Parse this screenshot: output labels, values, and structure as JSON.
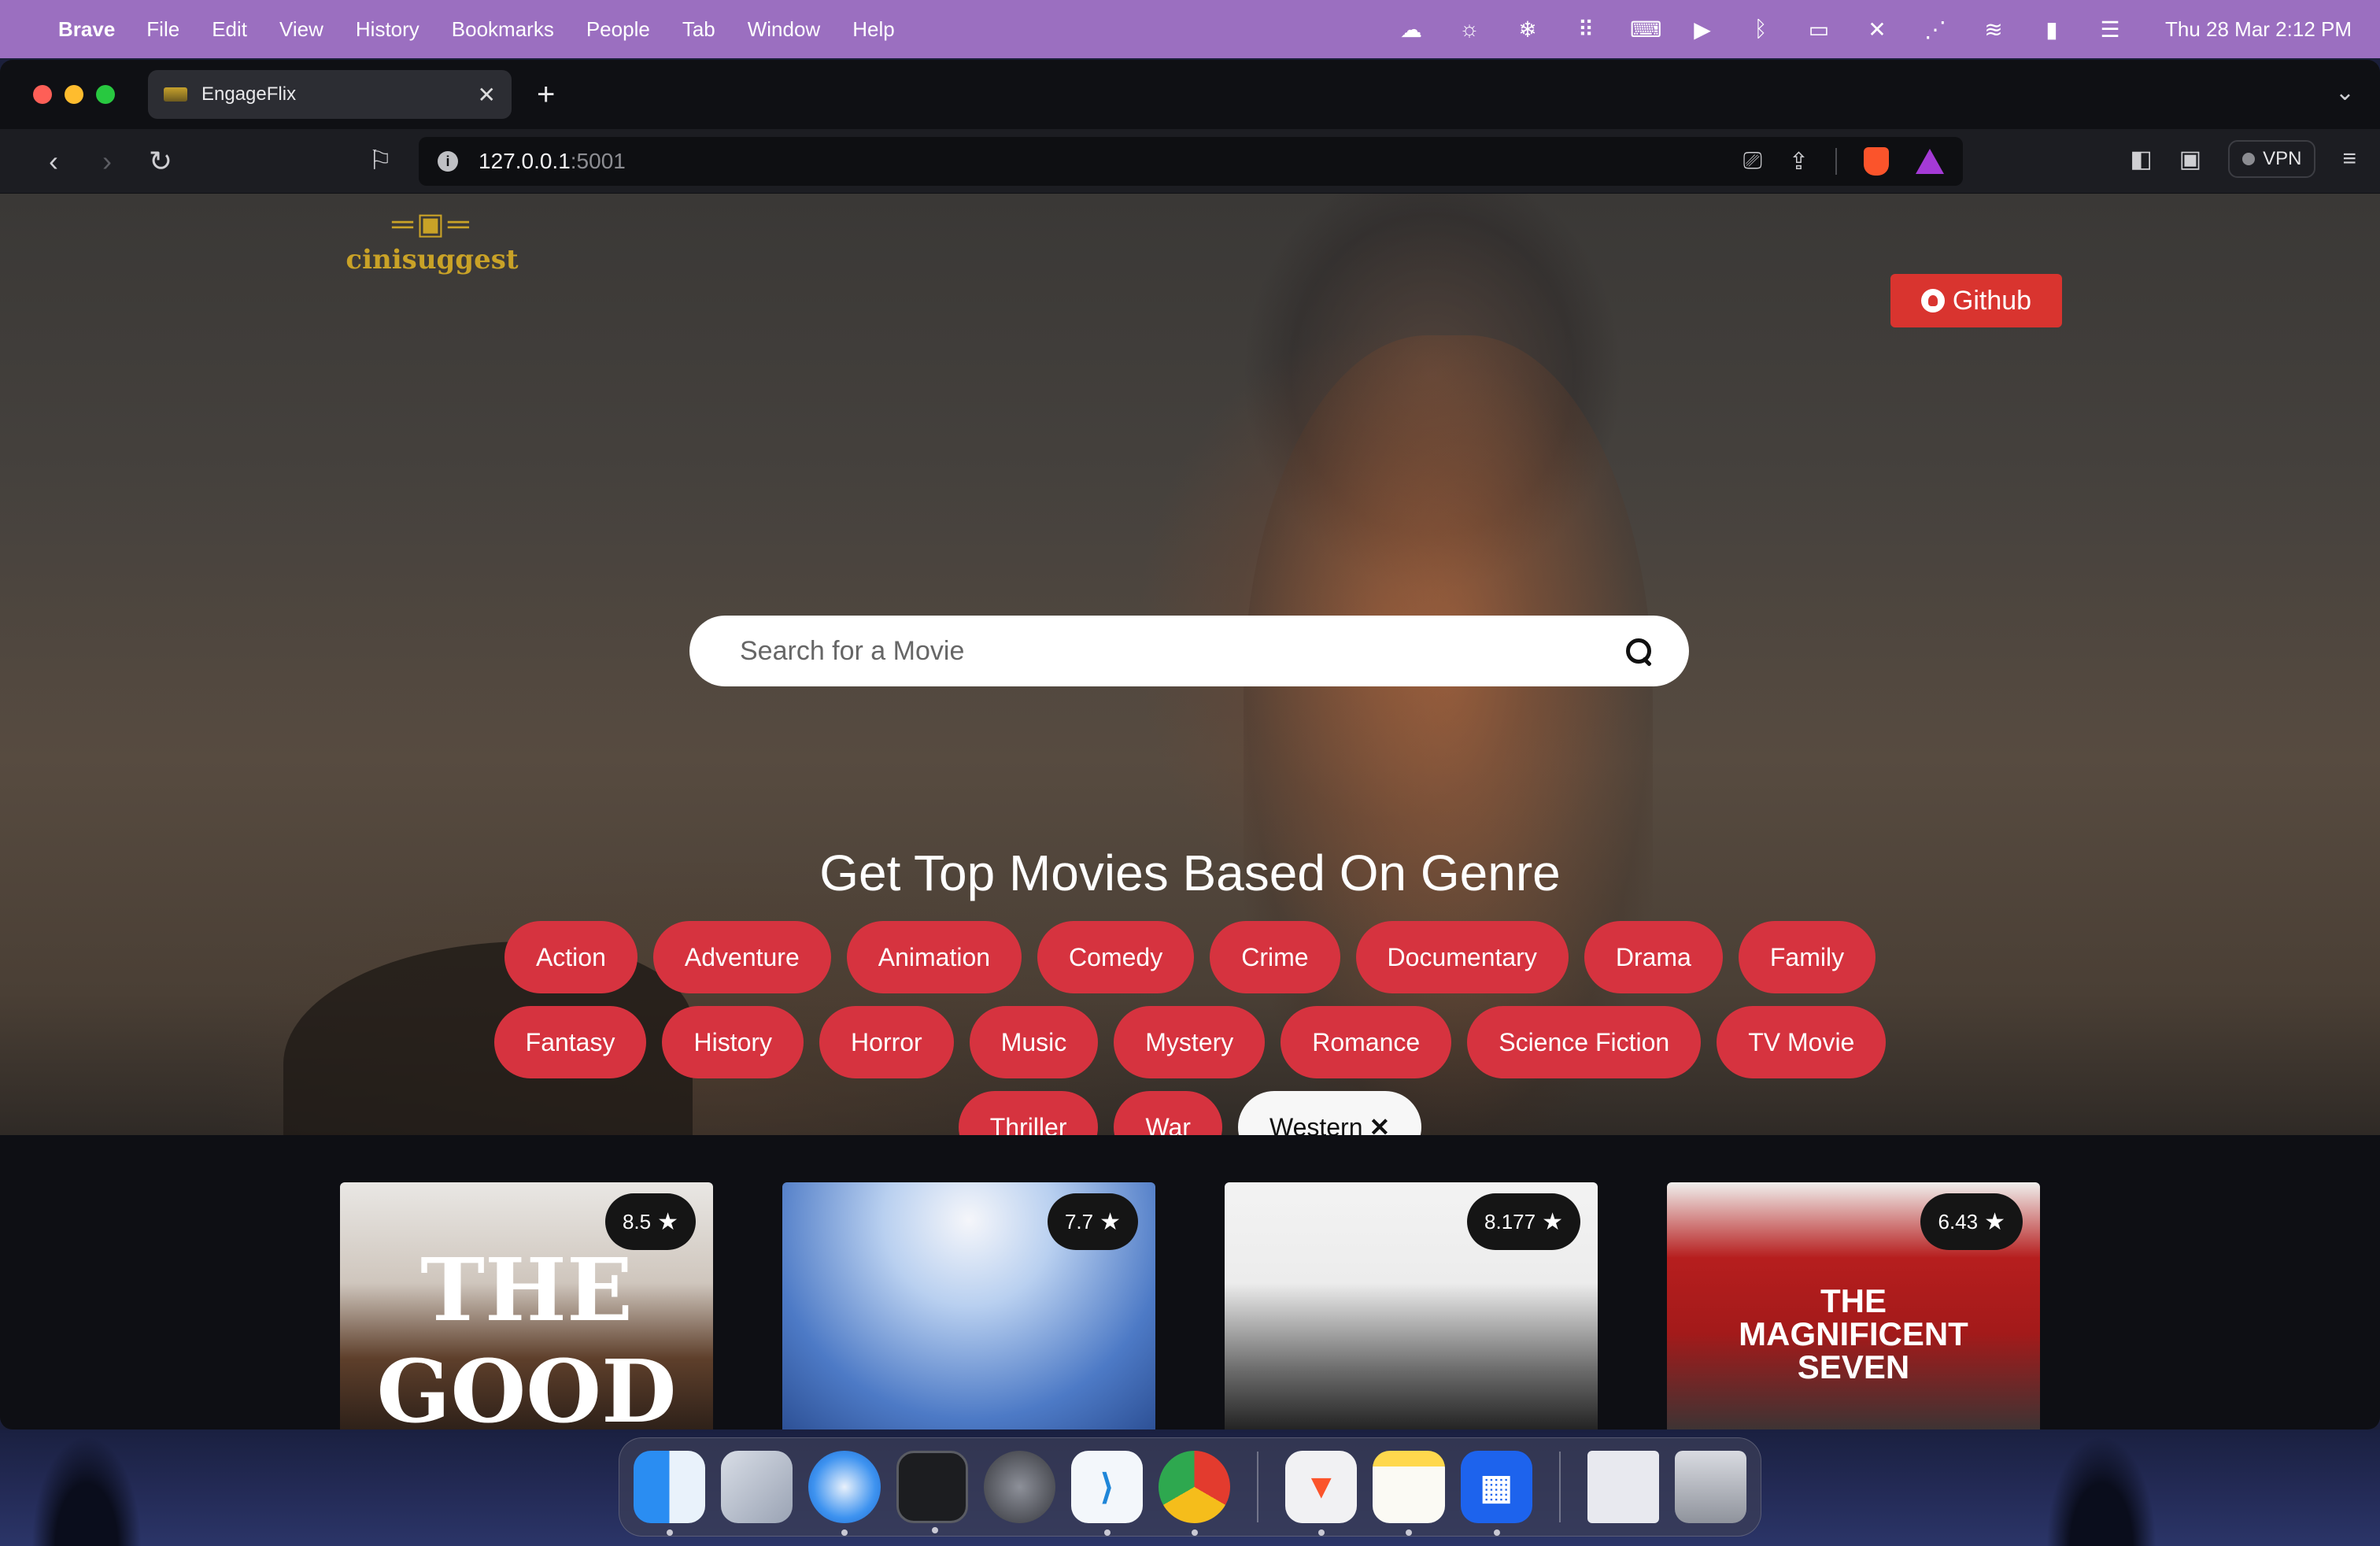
{
  "menubar": {
    "app_name": "Brave",
    "menus": [
      "File",
      "Edit",
      "View",
      "History",
      "Bookmarks",
      "People",
      "Tab",
      "Window",
      "Help"
    ],
    "status_icons": [
      "creative-cloud-icon",
      "brightness-icon",
      "snowflake-icon",
      "grid-dots-icon",
      "keyboard-icon",
      "play-circle-icon",
      "bluetooth-icon",
      "display-icon",
      "mute-icon",
      "dots-arc-icon",
      "wifi-icon",
      "battery-icon",
      "control-center-icon"
    ],
    "clock": "Thu 28 Mar  2:12 PM"
  },
  "browser": {
    "tab_title": "EngageFlix",
    "url_host": "127.0.0.1",
    "url_port": ":5001",
    "vpn_label": "VPN"
  },
  "page": {
    "logo_text": "cinisuggest",
    "github_label": "Github",
    "search_placeholder": "Search for a Movie",
    "heading": "Get Top Movies Based On Genre",
    "genres": [
      {
        "label": "Action",
        "active": false
      },
      {
        "label": "Adventure",
        "active": false
      },
      {
        "label": "Animation",
        "active": false
      },
      {
        "label": "Comedy",
        "active": false
      },
      {
        "label": "Crime",
        "active": false
      },
      {
        "label": "Documentary",
        "active": false
      },
      {
        "label": "Drama",
        "active": false
      },
      {
        "label": "Family",
        "active": false
      },
      {
        "label": "Fantasy",
        "active": false
      },
      {
        "label": "History",
        "active": false
      },
      {
        "label": "Horror",
        "active": false
      },
      {
        "label": "Music",
        "active": false
      },
      {
        "label": "Mystery",
        "active": false
      },
      {
        "label": "Romance",
        "active": false
      },
      {
        "label": "Science Fiction",
        "active": false
      },
      {
        "label": "TV Movie",
        "active": false
      },
      {
        "label": "Thriller",
        "active": false
      },
      {
        "label": "War",
        "active": false
      },
      {
        "label": "Western",
        "active": true
      }
    ],
    "active_genre_close": "✕",
    "movies": [
      {
        "rating": "8.5",
        "poster_text": "THE GOOD"
      },
      {
        "rating": "7.7",
        "poster_text": ""
      },
      {
        "rating": "8.177",
        "poster_text": ""
      },
      {
        "rating": "6.43",
        "poster_text": "THE MAGNIFICENT SEVEN"
      }
    ]
  },
  "colors": {
    "menubar": "#9b6fc0",
    "genre_chip": "#d6333f",
    "github_button": "#d9342f",
    "logo_gold": "#c9a227"
  },
  "dock": {
    "apps": [
      "finder-icon",
      "launchpad-icon",
      "safari-icon",
      "terminal-icon",
      "system-settings-icon",
      "vscode-icon",
      "chrome-icon",
      "brave-icon",
      "notes-icon",
      "docker-icon",
      "preview-icon",
      "trash-icon"
    ]
  }
}
